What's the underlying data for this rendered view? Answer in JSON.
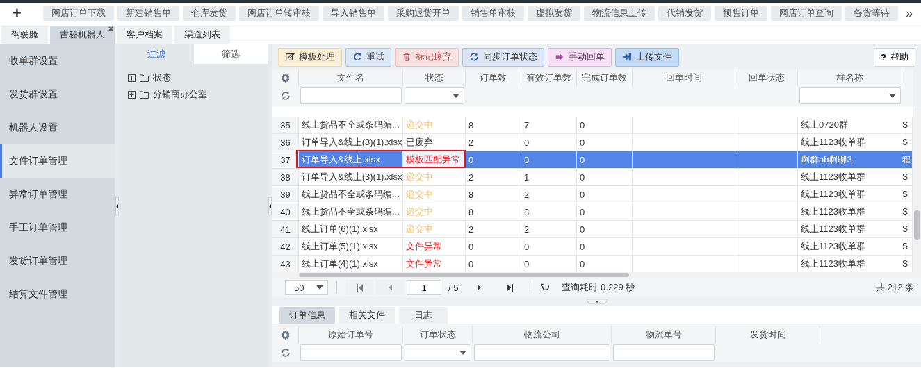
{
  "new_button": "+",
  "toolbar": [
    "网店订单下载",
    "新建销售单",
    "仓库发货",
    "网店订单转审核",
    "导入销售单",
    "采购退货开单",
    "销售单审核",
    "虚拟发货",
    "物流信息上传",
    "代销发货",
    "预售订单",
    "网店订单查询",
    "备货等待"
  ],
  "toolbar_more": "»",
  "page_tabs": [
    {
      "label": "驾驶舱",
      "selected": false,
      "closable": false
    },
    {
      "label": "吉秘机器人",
      "selected": true,
      "closable": true
    },
    {
      "label": "客户档案",
      "selected": false,
      "closable": false
    },
    {
      "label": "渠道列表",
      "selected": false,
      "closable": false
    }
  ],
  "sidebar": {
    "items": [
      {
        "label": "收单群设置",
        "selected": false
      },
      {
        "label": "发货群设置",
        "selected": false
      },
      {
        "label": "机器人设置",
        "selected": false
      },
      {
        "label": "文件订单管理",
        "selected": true
      },
      {
        "label": "异常订单管理",
        "selected": false
      },
      {
        "label": "手工订单管理",
        "selected": false
      },
      {
        "label": "发货订单管理",
        "selected": false
      },
      {
        "label": "结算文件管理",
        "selected": false
      }
    ]
  },
  "filter_panel": {
    "tabs": [
      {
        "label": "过滤",
        "selected": true
      },
      {
        "label": "筛选",
        "selected": false
      }
    ],
    "tree": [
      {
        "label": "状态",
        "expanded": false
      },
      {
        "label": "分销商办公室",
        "expanded": false
      }
    ]
  },
  "actions": [
    {
      "kind": "template",
      "label": "模板处理"
    },
    {
      "kind": "retry",
      "label": "重试"
    },
    {
      "kind": "discard",
      "label": "标记废弃"
    },
    {
      "kind": "sync",
      "label": "同步订单状态"
    },
    {
      "kind": "manual",
      "label": "手动回单"
    },
    {
      "kind": "upload",
      "label": "上传文件"
    }
  ],
  "help_icon": "?",
  "help_button": "帮助",
  "table": {
    "columns": [
      "文件名",
      "状态",
      "订单数",
      "有效订单数",
      "完成订单数",
      "回单时间",
      "回单状态",
      "群名称"
    ],
    "rows": [
      {
        "no": "35",
        "file": "线上货品不全或条码编...",
        "status": "递交中",
        "color": "#f5c06a",
        "orders": "8",
        "valid": "7",
        "done": "0",
        "group": "线上0720群",
        "column_10": "S",
        "selected": false,
        "outlined": false
      },
      {
        "no": "36",
        "file": "订单导入&线上(8)(1).xlsx",
        "status": "已废弃",
        "color": "#333333",
        "orders": "2",
        "valid": "0",
        "done": "0",
        "group": "线上1123收单群",
        "column_10": "S",
        "selected": false,
        "outlined": false
      },
      {
        "no": "37",
        "file": "订单导入&线上.xlsx",
        "status": "模板匹配异常",
        "color": "#ff1a1a",
        "orders": "0",
        "valid": "0",
        "done": "0",
        "group": "啊群ab啊聊3",
        "column_10": "程",
        "selected": true,
        "outlined": true
      },
      {
        "no": "38",
        "file": "订单导入&线上(3)(1).xlsx",
        "status": "递交中",
        "color": "#f5c06a",
        "orders": "2",
        "valid": "1",
        "done": "0",
        "group": "线上1123收单群",
        "column_10": "S",
        "selected": false,
        "outlined": false
      },
      {
        "no": "39",
        "file": "线上货品不全或条码编...",
        "status": "递交中",
        "color": "#f5c06a",
        "orders": "8",
        "valid": "2",
        "done": "0",
        "group": "线上1123收单群",
        "column_10": "S",
        "selected": false,
        "outlined": false
      },
      {
        "no": "40",
        "file": "线上货品不全或条码编...",
        "status": "递交中",
        "color": "#f5c06a",
        "orders": "8",
        "valid": "8",
        "done": "0",
        "group": "线上1123收单群",
        "column_10": "S",
        "selected": false,
        "outlined": false
      },
      {
        "no": "41",
        "file": "线上订单(6)(1).xlsx",
        "status": "递交中",
        "color": "#f5c06a",
        "orders": "2",
        "valid": "2",
        "done": "0",
        "group": "线上1123收单群",
        "column_10": "S",
        "selected": false,
        "outlined": false
      },
      {
        "no": "42",
        "file": "线上订单(5)(1).xlsx",
        "status": "文件异常",
        "color": "#ff1a1a",
        "orders": "0",
        "valid": "0",
        "done": "0",
        "group": "线上1123收单群",
        "column_10": "S",
        "selected": false,
        "outlined": false
      },
      {
        "no": "43",
        "file": "线上订单(4)(1).xlsx",
        "status": "文件异常",
        "color": "#ff1a1a",
        "orders": "0",
        "valid": "0",
        "done": "0",
        "group": "线上1123收单群",
        "column_10": "S",
        "selected": false,
        "outlined": false
      }
    ]
  },
  "pager": {
    "page_size": "50",
    "page": "1",
    "total_pages": "/ 5",
    "query_time": "查询耗时 0.229 秒",
    "total": "共 212 条"
  },
  "detail_tabs": [
    {
      "label": "订单信息",
      "selected": true
    },
    {
      "label": "相关文件",
      "selected": false
    },
    {
      "label": "日志",
      "selected": false
    }
  ],
  "detail_table": {
    "columns": [
      "原始订单号",
      "订单状态",
      "物流公司",
      "物流单号",
      "发货时间"
    ]
  }
}
